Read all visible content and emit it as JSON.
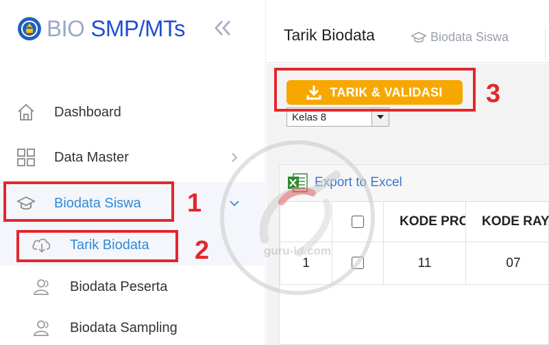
{
  "brand": {
    "bio": "BIO",
    "smp": "SMP/MTs"
  },
  "sidebar": {
    "items": [
      {
        "label": "Dashboard",
        "icon": "home-icon"
      },
      {
        "label": "Data Master",
        "icon": "grid-icon"
      },
      {
        "label": "Biodata Siswa",
        "icon": "graduation-cap-icon"
      }
    ],
    "subitems": [
      {
        "label": "Tarik Biodata",
        "icon": "cloud-download-icon"
      },
      {
        "label": "Biodata Peserta",
        "icon": "users-icon"
      },
      {
        "label": "Biodata Sampling",
        "icon": "users-icon"
      }
    ]
  },
  "header": {
    "title": "Tarik Biodata",
    "breadcrumb": "Biodata Siswa"
  },
  "toolbar": {
    "tarik_label": "TARIK & VALIDASI",
    "kelas_selected": "Kelas 8"
  },
  "table": {
    "export_label": "Export to Excel",
    "columns": [
      "",
      "",
      "KODE PRO",
      "KODE RAY"
    ],
    "rows": [
      {
        "no": "1",
        "kode_pro": "11",
        "kode_ray": "07"
      }
    ]
  },
  "annotations": [
    "1",
    "2",
    "3"
  ],
  "watermark_text": "guru-id.com",
  "colors": {
    "accent_blue": "#2e8ad8",
    "button_orange": "#f7a800",
    "annotation_red": "#e3262b"
  }
}
